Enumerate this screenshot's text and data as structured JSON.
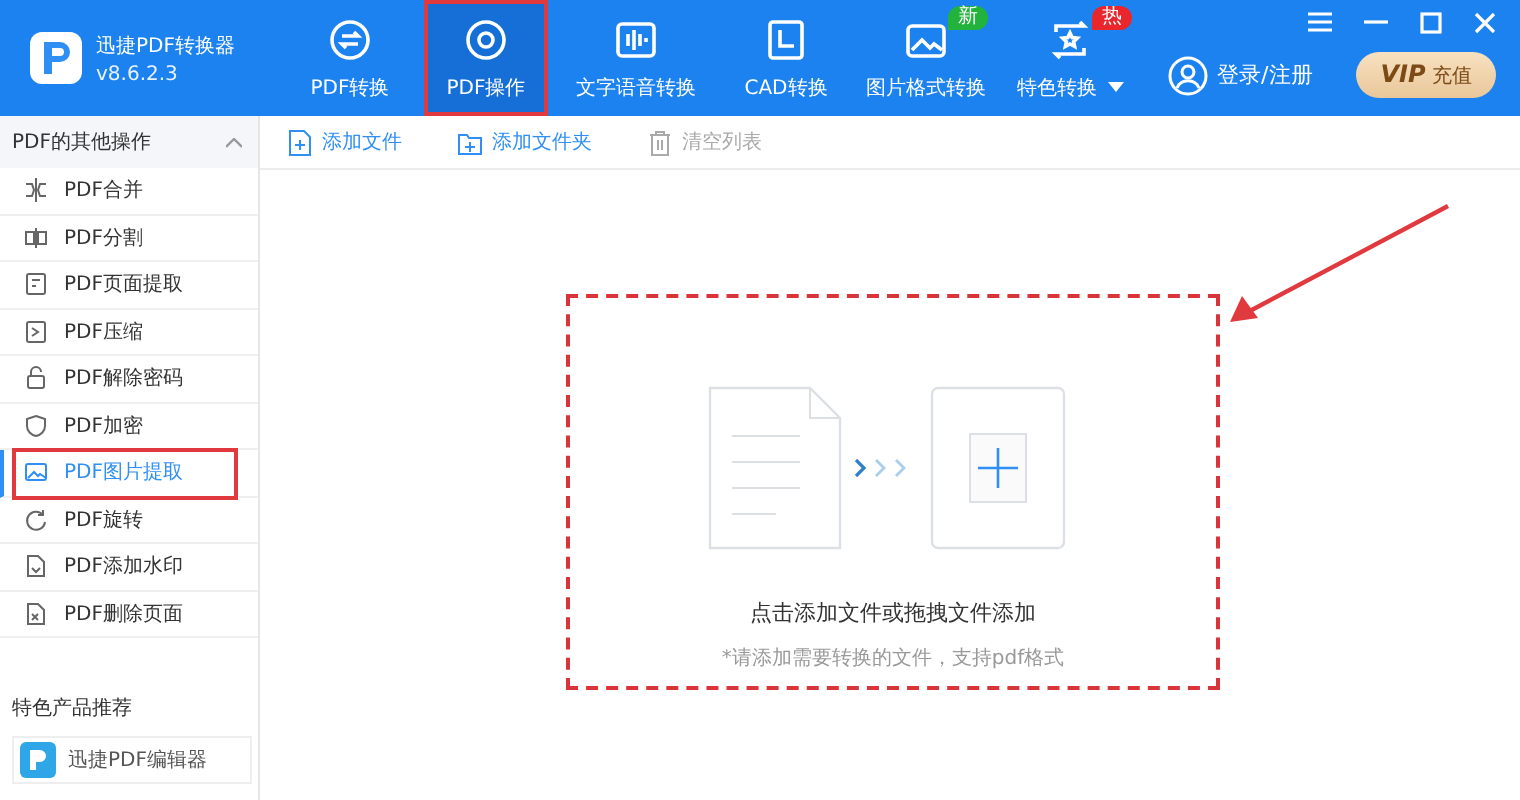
{
  "app": {
    "name": "迅捷PDF转换器",
    "version": "v8.6.2.3"
  },
  "nav": [
    {
      "label": "PDF转换",
      "kind": "convert",
      "selected": false,
      "highlighted": false
    },
    {
      "label": "PDF操作",
      "kind": "operate",
      "selected": true,
      "highlighted": true
    },
    {
      "label": "文字语音转换",
      "kind": "speech",
      "selected": false,
      "highlighted": false
    },
    {
      "label": "CAD转换",
      "kind": "cad",
      "selected": false,
      "highlighted": false
    },
    {
      "label": "图片格式转换",
      "kind": "image",
      "selected": false,
      "highlighted": false,
      "badge": {
        "text": "新",
        "color": "#21b33b"
      }
    },
    {
      "label": "特色转换",
      "kind": "special",
      "selected": false,
      "highlighted": false,
      "badge": {
        "text": "热",
        "color": "#e8262b"
      },
      "has_menu": true
    }
  ],
  "account": {
    "login": "登录/注册",
    "vip_mark": "VIP",
    "vip_text": "充值"
  },
  "sidebar": {
    "title": "PDF的其他操作",
    "expanded": true,
    "items": [
      {
        "label": "PDF合并",
        "kind": "merge",
        "selected": false,
        "highlighted": false
      },
      {
        "label": "PDF分割",
        "kind": "split",
        "selected": false,
        "highlighted": false
      },
      {
        "label": "PDF页面提取",
        "kind": "page",
        "selected": false,
        "highlighted": false
      },
      {
        "label": "PDF压缩",
        "kind": "compress",
        "selected": false,
        "highlighted": false
      },
      {
        "label": "PDF解除密码",
        "kind": "unlock",
        "selected": false,
        "highlighted": false
      },
      {
        "label": "PDF加密",
        "kind": "shield",
        "selected": false,
        "highlighted": false
      },
      {
        "label": "PDF图片提取",
        "kind": "image",
        "selected": true,
        "highlighted": true
      },
      {
        "label": "PDF旋转",
        "kind": "rotate",
        "selected": false,
        "highlighted": false
      },
      {
        "label": "PDF添加水印",
        "kind": "watermark",
        "selected": false,
        "highlighted": false
      },
      {
        "label": "PDF删除页面",
        "kind": "delete",
        "selected": false,
        "highlighted": false
      }
    ],
    "featured_title": "特色产品推荐",
    "products": [
      {
        "name": "迅捷PDF编辑器"
      }
    ]
  },
  "toolbar": [
    {
      "label": "添加文件",
      "kind": "file",
      "disabled": false
    },
    {
      "label": "添加文件夹",
      "kind": "folder",
      "disabled": false
    },
    {
      "label": "清空列表",
      "kind": "trash",
      "disabled": true
    }
  ],
  "dropzone": {
    "highlighted": true,
    "title": "点击添加文件或拖拽文件添加",
    "hint": "*请添加需要转换的文件，支持pdf格式"
  },
  "annotation_arrow": true
}
